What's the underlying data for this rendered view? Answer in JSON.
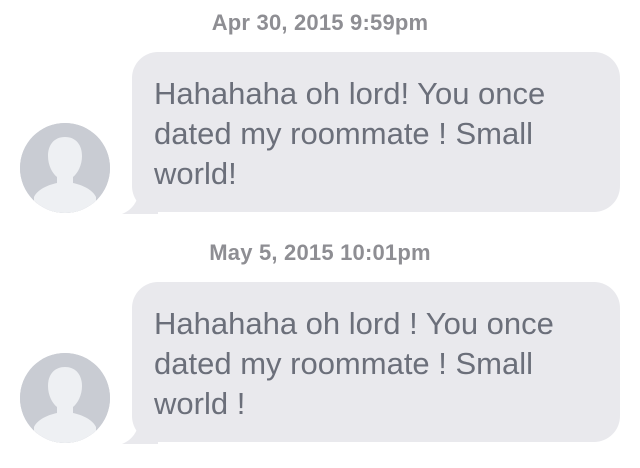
{
  "messages": [
    {
      "timestamp": "Apr 30, 2015 9:59pm",
      "text": "Hahahaha oh lord! You once dated my roommate ! Small world!",
      "avatar_icon": "default-user-silhouette-icon"
    },
    {
      "timestamp": "May 5, 2015 10:01pm",
      "text": "Hahahaha oh lord ! You once dated my roommate ! Small world !",
      "avatar_icon": "default-user-silhouette-icon"
    }
  ],
  "colors": {
    "bubble": "#e9e9ed",
    "text": "#6b6f7a",
    "timestamp": "#8e8e93",
    "avatar_bg": "#c9ccd3",
    "avatar_fg": "#eef0f3"
  }
}
